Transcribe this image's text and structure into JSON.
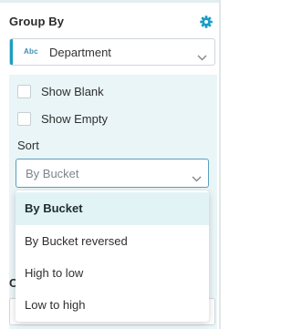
{
  "group_by": {
    "title": "Group By",
    "settings_icon": "gear-icon",
    "field_type_badge": "Abc",
    "field_value": "Department",
    "accent_color": "#1a9dc4"
  },
  "options": {
    "show_blank_label": "Show Blank",
    "show_blank_checked": false,
    "show_empty_label": "Show Empty",
    "show_empty_checked": false,
    "sort_label": "Sort",
    "sort_value": "By Bucket",
    "panel_color": "#eaf5f7"
  },
  "sort_menu": {
    "items": [
      {
        "label": "By Bucket",
        "selected": true
      },
      {
        "label": "By Bucket reversed",
        "selected": false
      },
      {
        "label": "High to low",
        "selected": false
      },
      {
        "label": "Low to high",
        "selected": false
      }
    ]
  },
  "next_section": {
    "label_partial": "C"
  }
}
